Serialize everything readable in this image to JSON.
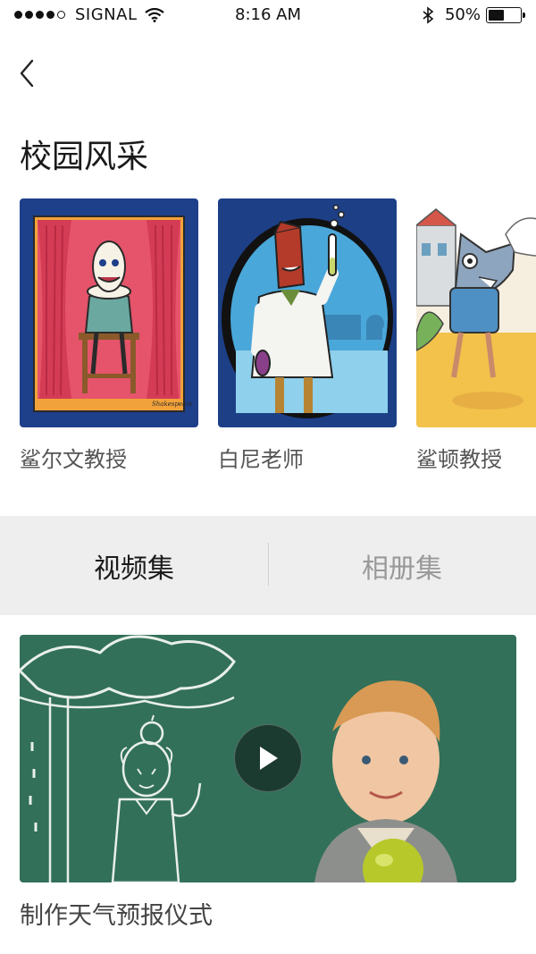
{
  "status_bar": {
    "carrier": "SIGNAL",
    "time": "8:16 AM",
    "battery_percent": "50%",
    "battery_level": 0.5
  },
  "header": {
    "back_icon": "chevron-left-icon",
    "title": "校园风采"
  },
  "profiles": [
    {
      "name": "鲨尔文教授",
      "image": "shark-shakespeare-illustration"
    },
    {
      "name": "白尼老师",
      "image": "scientist-illustration"
    },
    {
      "name": "鲨顿教授",
      "image": "shark-cartoon-illustration"
    }
  ],
  "tabs": [
    {
      "label": "视频集",
      "active": true
    },
    {
      "label": "相册集",
      "active": false
    }
  ],
  "videos": [
    {
      "title": "制作天气预报仪式",
      "play_icon": "play-icon"
    }
  ],
  "colors": {
    "tab_bar_bg": "#eeeeee",
    "chalkboard": "#2f6b57"
  }
}
